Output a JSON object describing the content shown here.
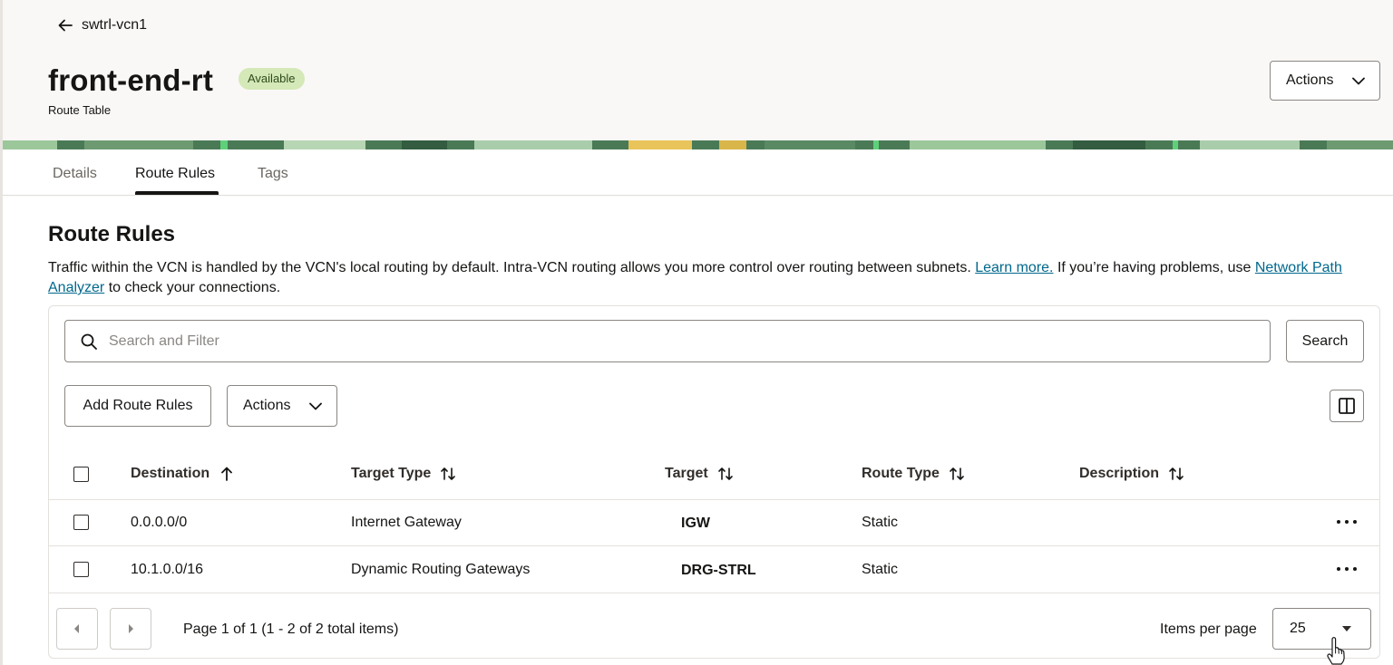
{
  "header": {
    "back_label": "swtrl-vcn1",
    "title": "front-end-rt",
    "status_badge": "Available",
    "subtitle": "Route Table",
    "actions_label": "Actions"
  },
  "tabs": [
    {
      "label": "Details",
      "active": false
    },
    {
      "label": "Route Rules",
      "active": true
    },
    {
      "label": "Tags",
      "active": false
    }
  ],
  "section": {
    "title": "Route Rules",
    "desc_pre": "Traffic within the VCN is handled by the VCN's local routing by default. Intra-VCN routing allows you more control over routing between subnets. ",
    "learn_more": "Learn more.",
    "desc_mid": " If you’re having problems, use ",
    "npa_link": "Network Path Analyzer",
    "desc_post": " to check your connections."
  },
  "search": {
    "placeholder": "Search and Filter",
    "value": "",
    "button_label": "Search"
  },
  "toolbar": {
    "add_label": "Add Route Rules",
    "actions_label": "Actions"
  },
  "table": {
    "columns": [
      "Destination",
      "Target Type",
      "Target",
      "Route Type",
      "Description"
    ],
    "rows": [
      {
        "destination": "0.0.0.0/0",
        "target_type": "Internet Gateway",
        "target": "IGW",
        "route_type": "Static",
        "description": ""
      },
      {
        "destination": "10.1.0.0/16",
        "target_type": "Dynamic Routing Gateways",
        "target": "DRG-STRL",
        "route_type": "Static",
        "description": ""
      }
    ]
  },
  "pagination": {
    "text": "Page 1 of 1 (1 - 2 of 2 total items)",
    "items_per_page_label": "Items per page",
    "items_per_page_value": "25"
  },
  "colors": {
    "badge_bg": "#d4e8b8",
    "link": "#00688c",
    "header_bg": "#f9f8f6"
  }
}
